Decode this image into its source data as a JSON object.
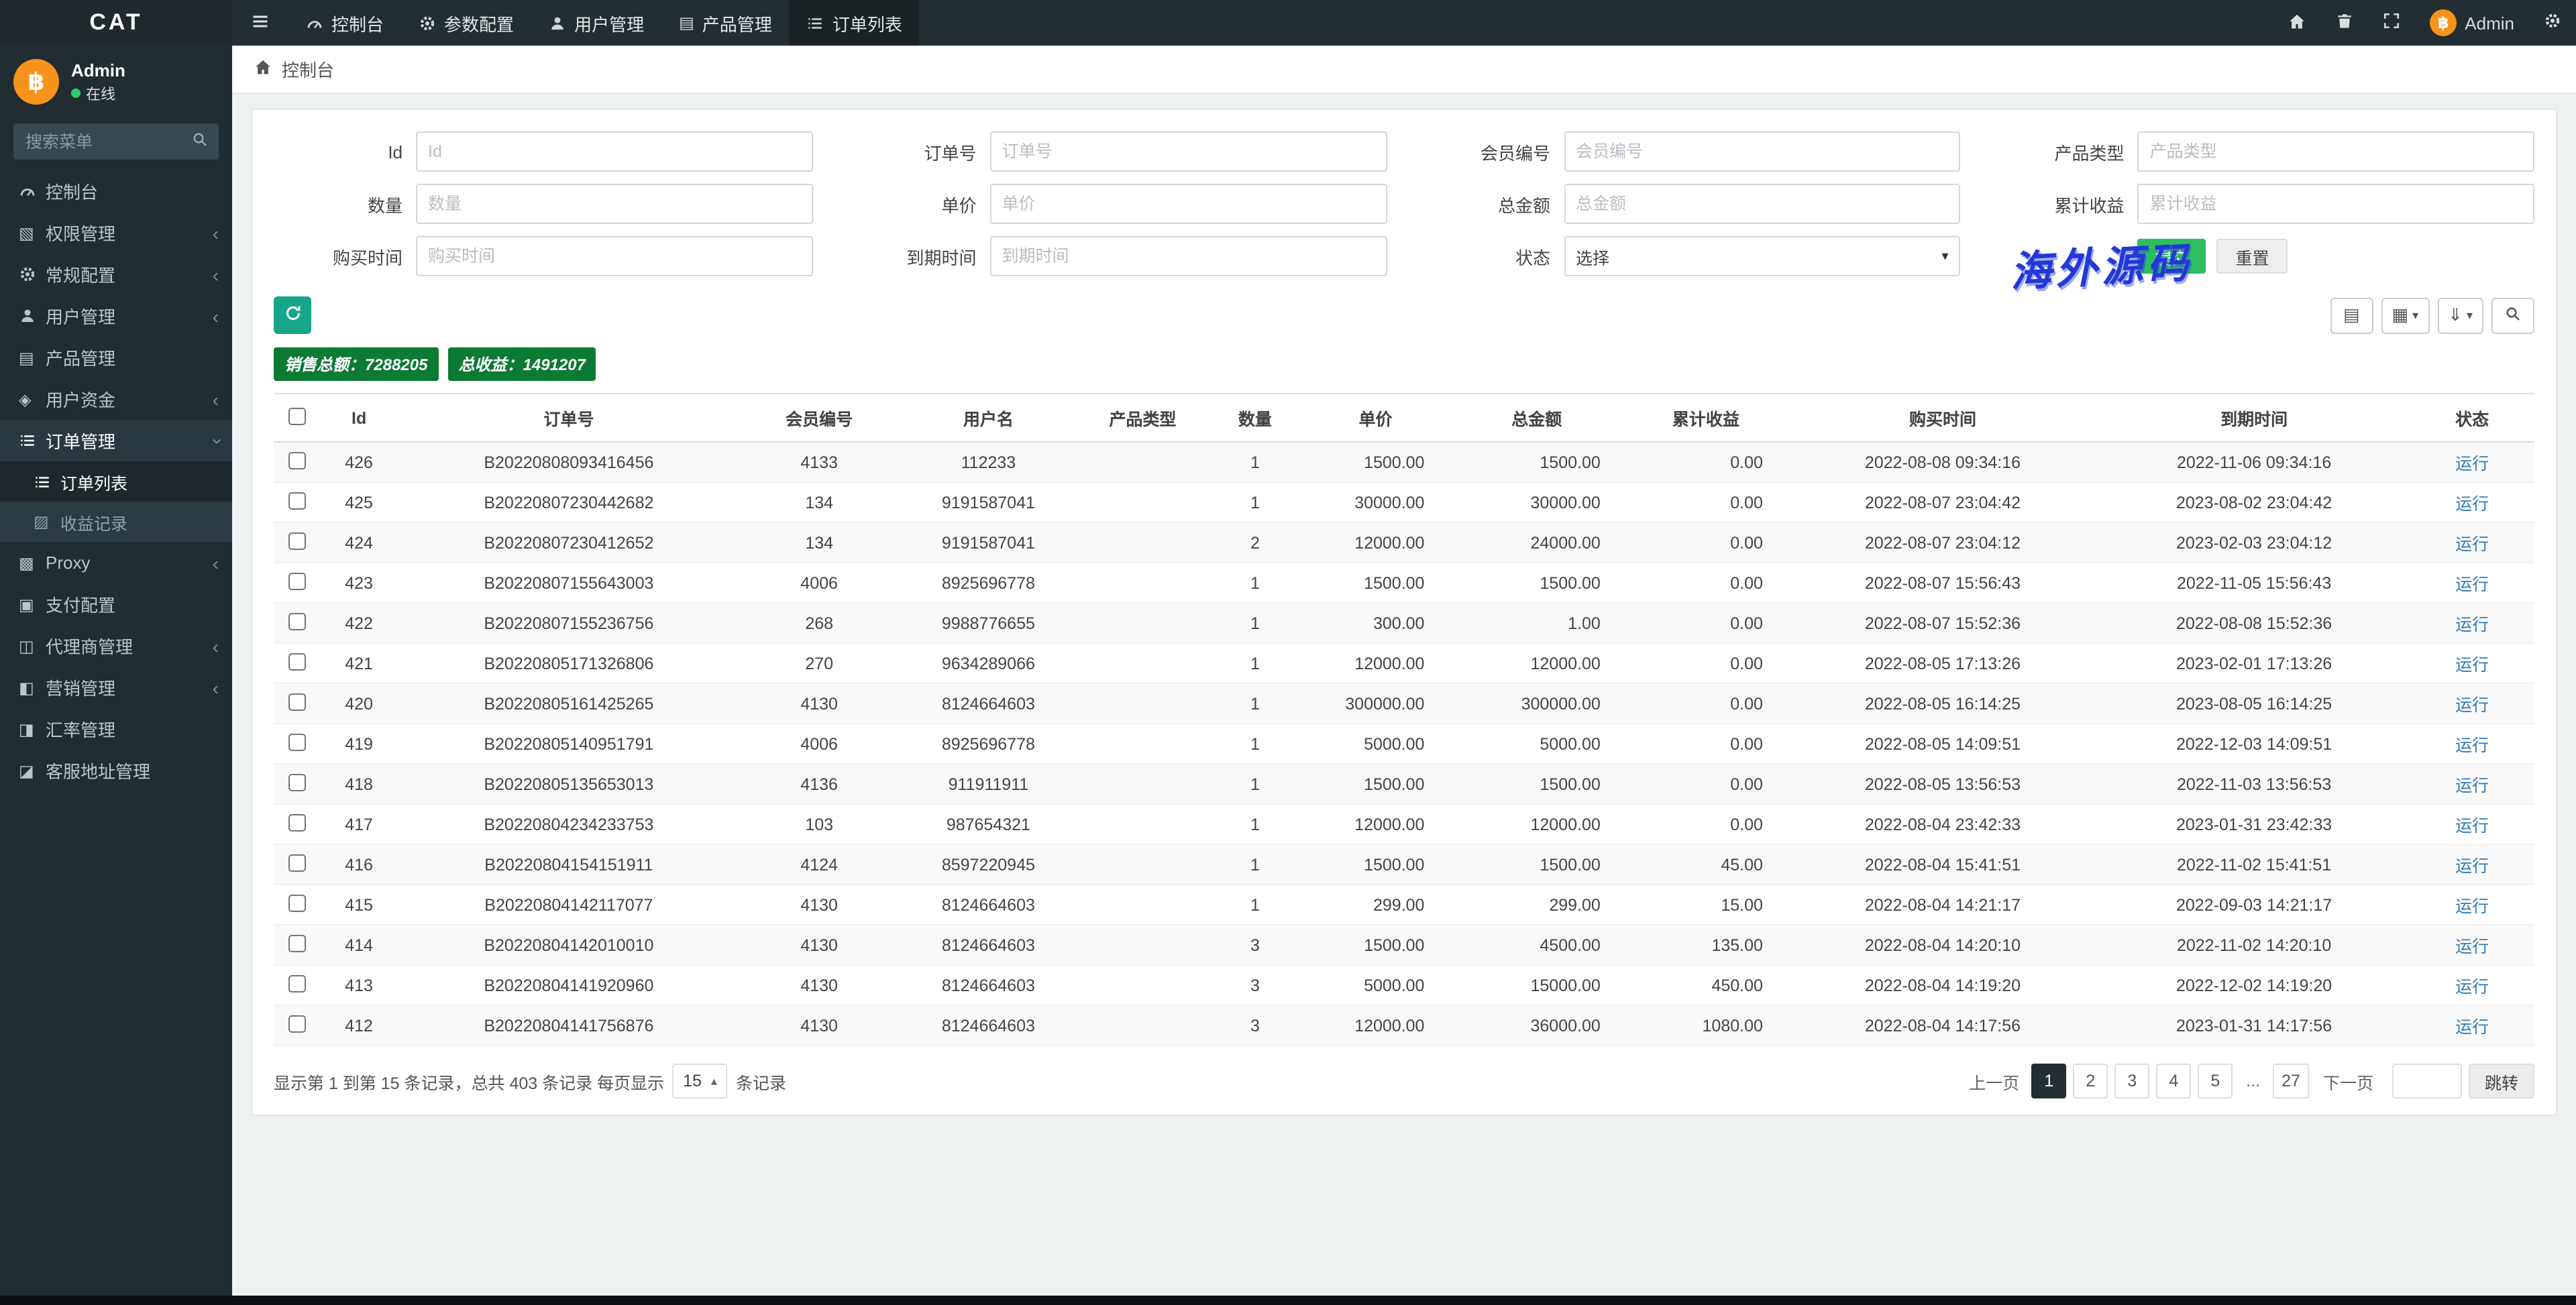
{
  "app": {
    "logo": "CAT",
    "watermark": "海外源码"
  },
  "navbar": {
    "tabs": [
      {
        "name": "dashboard",
        "label": "控制台",
        "icon": "dashboard-icon",
        "active": false
      },
      {
        "name": "params-config",
        "label": "参数配置",
        "icon": "gear-icon",
        "active": false
      },
      {
        "name": "user-management",
        "label": "用户管理",
        "icon": "user-icon",
        "active": false
      },
      {
        "name": "product-management",
        "label": "产品管理",
        "icon": "product-icon",
        "active": false
      },
      {
        "name": "order-list",
        "label": "订单列表",
        "icon": "list-icon",
        "active": true
      }
    ],
    "right": {
      "user_name": "Admin",
      "avatar_glyph": "฿"
    }
  },
  "sidebar": {
    "user": {
      "name": "Admin",
      "status": "在线",
      "avatar_glyph": "฿"
    },
    "search_placeholder": "搜索菜单",
    "items": [
      {
        "name": "dashboard",
        "label": "控制台",
        "icon": "dashboard-icon"
      },
      {
        "name": "permission",
        "label": "权限管理",
        "icon": "shield-icon",
        "chevron": true
      },
      {
        "name": "general-config",
        "label": "常规配置",
        "icon": "gear-icon",
        "chevron": true
      },
      {
        "name": "user-management",
        "label": "用户管理",
        "icon": "user-icon",
        "chevron": true
      },
      {
        "name": "product-management",
        "label": "产品管理",
        "icon": "product-icon"
      },
      {
        "name": "user-funds",
        "label": "用户资金",
        "icon": "funds-icon",
        "chevron": true
      },
      {
        "name": "order-management",
        "label": "订单管理",
        "icon": "order-icon",
        "expanded": true,
        "children": [
          {
            "name": "order-list",
            "label": "订单列表",
            "icon": "list-icon",
            "active": true
          },
          {
            "name": "profit-records",
            "label": "收益记录",
            "icon": "records-icon"
          }
        ]
      },
      {
        "name": "proxy",
        "label": "Proxy",
        "icon": "proxy-icon",
        "chevron": true
      },
      {
        "name": "payment-config",
        "label": "支付配置",
        "icon": "pay-icon"
      },
      {
        "name": "agent-management",
        "label": "代理商管理",
        "icon": "agent-icon",
        "chevron": true
      },
      {
        "name": "marketing",
        "label": "营销管理",
        "icon": "marketing-icon",
        "chevron": true
      },
      {
        "name": "exchange-rate",
        "label": "汇率管理",
        "icon": "rate-icon"
      },
      {
        "name": "service-address",
        "label": "客服地址管理",
        "icon": "service-icon"
      }
    ]
  },
  "breadcrumb": {
    "label": "控制台"
  },
  "filters": {
    "fields": [
      {
        "name": "id",
        "label": "Id",
        "placeholder": "Id"
      },
      {
        "name": "order-no",
        "label": "订单号",
        "placeholder": "订单号"
      },
      {
        "name": "member-no",
        "label": "会员编号",
        "placeholder": "会员编号"
      },
      {
        "name": "product-type",
        "label": "产品类型",
        "placeholder": "产品类型"
      },
      {
        "name": "quantity",
        "label": "数量",
        "placeholder": "数量"
      },
      {
        "name": "unit-price",
        "label": "单价",
        "placeholder": "单价"
      },
      {
        "name": "total-amount",
        "label": "总金额",
        "placeholder": "总金额"
      },
      {
        "name": "total-profit",
        "label": "累计收益",
        "placeholder": "累计收益"
      },
      {
        "name": "buy-time",
        "label": "购买时间",
        "placeholder": "购买时间"
      },
      {
        "name": "expire-time",
        "label": "到期时间",
        "placeholder": "到期时间"
      }
    ],
    "status": {
      "label": "状态",
      "value": "选择"
    },
    "submit_label": "提交",
    "reset_label": "重置"
  },
  "summary": {
    "sales_label": "销售总额：",
    "sales_value": "7288205",
    "profit_label": "总收益：",
    "profit_value": "1491207"
  },
  "table": {
    "columns": [
      "Id",
      "订单号",
      "会员编号",
      "用户名",
      "产品类型",
      "数量",
      "单价",
      "总金额",
      "累计收益",
      "购买时间",
      "到期时间",
      "状态"
    ],
    "rows": [
      [
        "426",
        "B20220808093416456",
        "4133",
        "112233",
        "",
        "1",
        "1500.00",
        "1500.00",
        "0.00",
        "2022-08-08 09:34:16",
        "2022-11-06 09:34:16",
        "运行"
      ],
      [
        "425",
        "B20220807230442682",
        "134",
        "9191587041",
        "",
        "1",
        "30000.00",
        "30000.00",
        "0.00",
        "2022-08-07 23:04:42",
        "2023-08-02 23:04:42",
        "运行"
      ],
      [
        "424",
        "B20220807230412652",
        "134",
        "9191587041",
        "",
        "2",
        "12000.00",
        "24000.00",
        "0.00",
        "2022-08-07 23:04:12",
        "2023-02-03 23:04:12",
        "运行"
      ],
      [
        "423",
        "B20220807155643003",
        "4006",
        "8925696778",
        "",
        "1",
        "1500.00",
        "1500.00",
        "0.00",
        "2022-08-07 15:56:43",
        "2022-11-05 15:56:43",
        "运行"
      ],
      [
        "422",
        "B20220807155236756",
        "268",
        "9988776655",
        "",
        "1",
        "300.00",
        "1.00",
        "0.00",
        "2022-08-07 15:52:36",
        "2022-08-08 15:52:36",
        "运行"
      ],
      [
        "421",
        "B20220805171326806",
        "270",
        "9634289066",
        "",
        "1",
        "12000.00",
        "12000.00",
        "0.00",
        "2022-08-05 17:13:26",
        "2023-02-01 17:13:26",
        "运行"
      ],
      [
        "420",
        "B20220805161425265",
        "4130",
        "8124664603",
        "",
        "1",
        "300000.00",
        "300000.00",
        "0.00",
        "2022-08-05 16:14:25",
        "2023-08-05 16:14:25",
        "运行"
      ],
      [
        "419",
        "B20220805140951791",
        "4006",
        "8925696778",
        "",
        "1",
        "5000.00",
        "5000.00",
        "0.00",
        "2022-08-05 14:09:51",
        "2022-12-03 14:09:51",
        "运行"
      ],
      [
        "418",
        "B20220805135653013",
        "4136",
        "911911911",
        "",
        "1",
        "1500.00",
        "1500.00",
        "0.00",
        "2022-08-05 13:56:53",
        "2022-11-03 13:56:53",
        "运行"
      ],
      [
        "417",
        "B20220804234233753",
        "103",
        "987654321",
        "",
        "1",
        "12000.00",
        "12000.00",
        "0.00",
        "2022-08-04 23:42:33",
        "2023-01-31 23:42:33",
        "运行"
      ],
      [
        "416",
        "B20220804154151911",
        "4124",
        "8597220945",
        "",
        "1",
        "1500.00",
        "1500.00",
        "45.00",
        "2022-08-04 15:41:51",
        "2022-11-02 15:41:51",
        "运行"
      ],
      [
        "415",
        "B20220804142117077",
        "4130",
        "8124664603",
        "",
        "1",
        "299.00",
        "299.00",
        "15.00",
        "2022-08-04 14:21:17",
        "2022-09-03 14:21:17",
        "运行"
      ],
      [
        "414",
        "B20220804142010010",
        "4130",
        "8124664603",
        "",
        "3",
        "1500.00",
        "4500.00",
        "135.00",
        "2022-08-04 14:20:10",
        "2022-11-02 14:20:10",
        "运行"
      ],
      [
        "413",
        "B20220804141920960",
        "4130",
        "8124664603",
        "",
        "3",
        "5000.00",
        "15000.00",
        "450.00",
        "2022-08-04 14:19:20",
        "2022-12-02 14:19:20",
        "运行"
      ],
      [
        "412",
        "B20220804141756876",
        "4130",
        "8124664603",
        "",
        "3",
        "12000.00",
        "36000.00",
        "1080.00",
        "2022-08-04 14:17:56",
        "2023-01-31 14:17:56",
        "运行"
      ]
    ]
  },
  "pagination": {
    "summary": "显示第 1 到第 15 条记录，总共 403 条记录 每页显示",
    "per_page": "15",
    "summary_suffix": "条记录",
    "prev": "上一页",
    "next": "下一页",
    "pages": [
      "1",
      "2",
      "3",
      "4",
      "5",
      "...",
      "27"
    ],
    "active_page": "1",
    "jump_label": "跳转"
  }
}
